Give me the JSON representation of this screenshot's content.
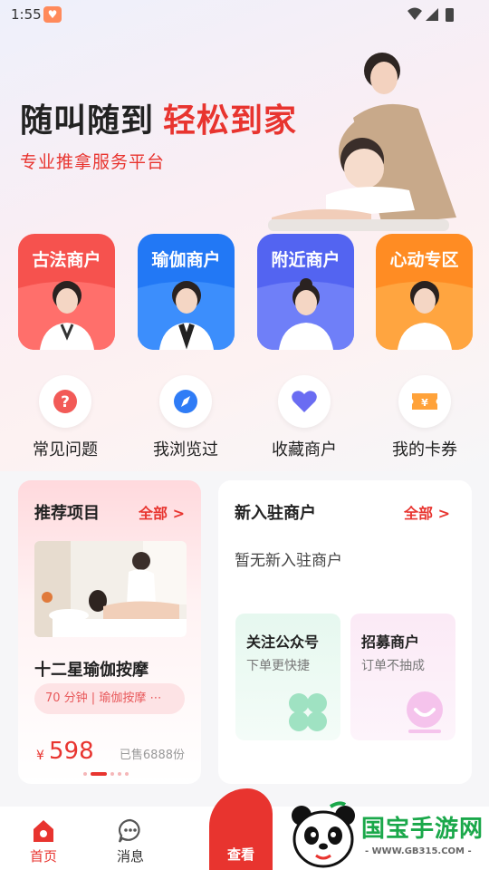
{
  "status_bar": {
    "time": "1:55",
    "app_icon": "heart-app-icon",
    "icons": [
      "wifi-icon",
      "signal-icon",
      "battery-icon"
    ]
  },
  "hero": {
    "title_dark": "随叫随到",
    "title_red": "轻松到家",
    "subtitle": "专业推拿服务平台"
  },
  "categories": [
    {
      "label": "古法商户",
      "color_top": "#ff6b68",
      "color_bottom": "#f13e3b"
    },
    {
      "label": "瑜伽商户",
      "color_top": "#3b8ffb",
      "color_bottom": "#1f6ff2"
    },
    {
      "label": "附近商户",
      "color_top": "#6b7cf8",
      "color_bottom": "#4f5ff0"
    },
    {
      "label": "心动专区",
      "color_top": "#ffa43d",
      "color_bottom": "#ff8a1f"
    }
  ],
  "quick_links": [
    {
      "label": "常见问题",
      "icon": "question-icon"
    },
    {
      "label": "我浏览过",
      "icon": "compass-icon"
    },
    {
      "label": "收藏商户",
      "icon": "heart-icon"
    },
    {
      "label": "我的卡券",
      "icon": "coupon-icon"
    }
  ],
  "recommend": {
    "title": "推荐项目",
    "more": "全部 >",
    "name": "十二星瑜伽按摩",
    "tag": "70 分钟 | 瑜伽按摩 ⋯",
    "price_symbol": "¥",
    "price": "598",
    "sold": "已售6888份"
  },
  "new_merchants": {
    "title": "新入驻商户",
    "more": "全部 >",
    "empty": "暂无新入驻商户",
    "follow": {
      "title": "关注公众号",
      "subtitle": "下单更快捷",
      "icon": "clover-icon"
    },
    "recruit": {
      "title": "招募商户",
      "subtitle": "订单不抽成",
      "icon": "smile-badge-icon"
    }
  },
  "bottom_nav": {
    "home": "首页",
    "messages": "消息",
    "center": "查看"
  },
  "watermark": {
    "text": "国宝手游网",
    "url": "- WWW.GB315.COM -"
  },
  "colors": {
    "accent": "#e8342f"
  }
}
